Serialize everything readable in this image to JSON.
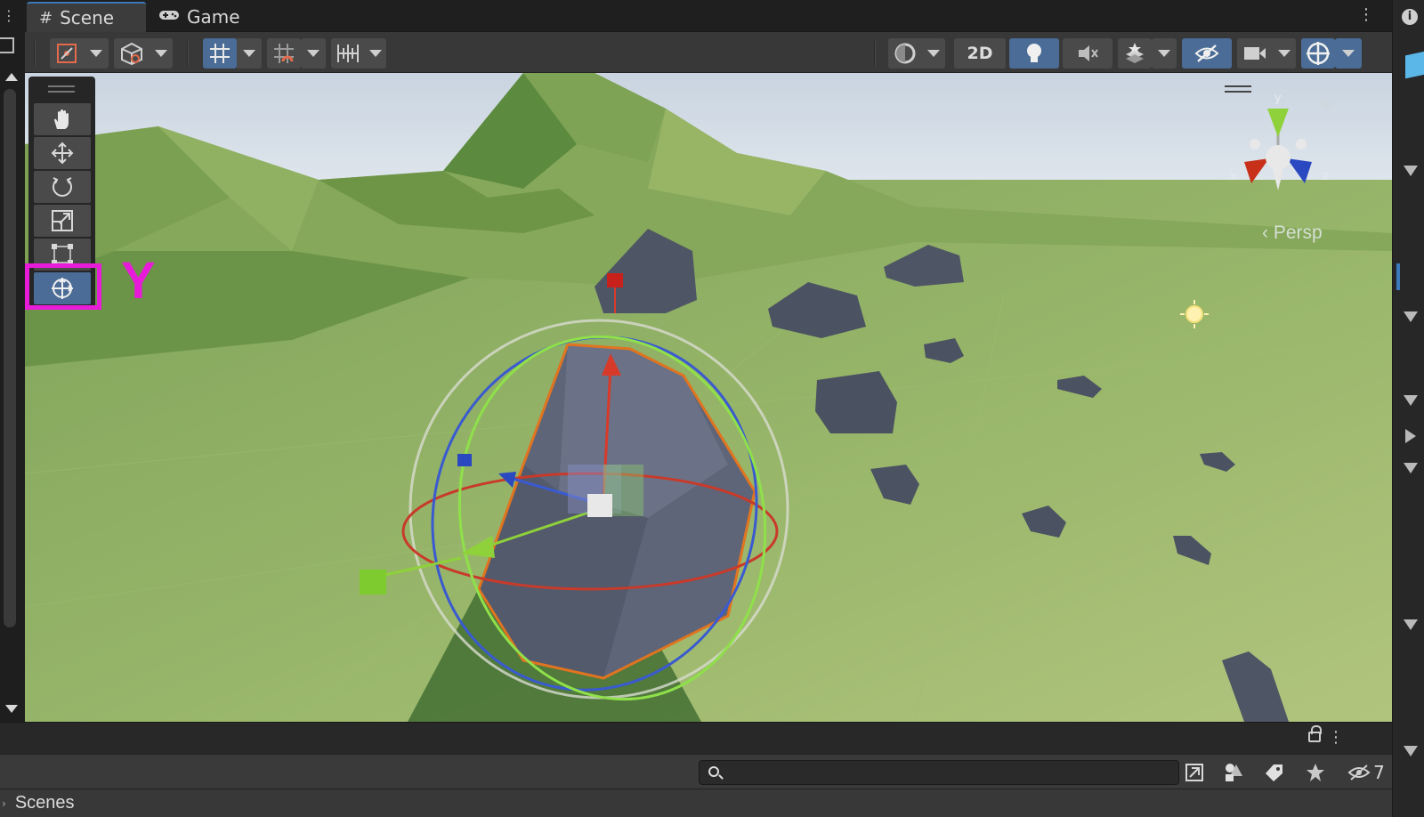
{
  "tabs": [
    {
      "label": "Scene",
      "glyph": "#",
      "active": true
    },
    {
      "label": "Game",
      "glyph": "🎮",
      "active": false
    }
  ],
  "toolbar": {
    "btn_2d_label": "2D",
    "icons": [
      "draw-mode-icon",
      "shading-mode-icon",
      "grid-snap-icon",
      "increment-snap-icon",
      "ruler-icon",
      "render-mode-icon",
      "lighting-icon",
      "audio-icon",
      "effects-icon",
      "hidden-objects-icon",
      "camera-icon",
      "gizmos-icon"
    ]
  },
  "palette": {
    "tools": [
      "hand-tool",
      "move-tool",
      "rotate-tool",
      "scale-tool",
      "rect-tool",
      "transform-tool"
    ],
    "selected": "transform-tool"
  },
  "annotation": {
    "label": "Y",
    "color": "#e81bd9"
  },
  "viewport": {
    "projection_label": "Persp",
    "axis_labels": {
      "x": "x",
      "y": "y",
      "z": "z"
    }
  },
  "bottom": {
    "search_placeholder": "",
    "hidden_count": "7",
    "scenes_label": "Scenes"
  },
  "colors": {
    "accent_blue": "#4a6c96",
    "highlight_magenta": "#e81bd9",
    "axis_x": "#d94a3a",
    "axis_y": "#8fd13a",
    "axis_z": "#3a6ad9"
  }
}
